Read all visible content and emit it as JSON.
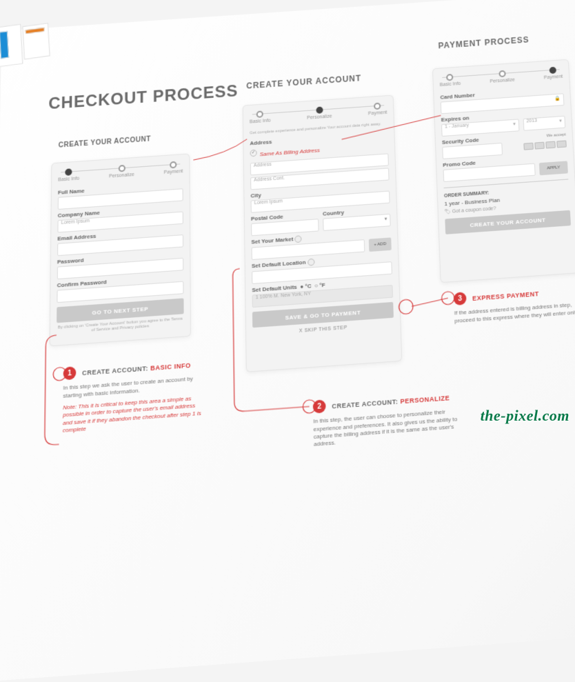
{
  "main_title": "CHECKOUT PROCESS",
  "columns": {
    "col1": {
      "title": "CREATE YOUR ACCOUNT"
    },
    "col2": {
      "title": "CREATE YOUR ACCOUNT"
    },
    "col3": {
      "title": "PAYMENT PROCESS"
    }
  },
  "steps": {
    "s1": "Basic Info",
    "s2": "Personalize",
    "s3": "Payment"
  },
  "panel1": {
    "full_name": "Full Name",
    "company": "Company Name",
    "company_val": "Lorem Ipsum",
    "email": "Email Address",
    "password": "Password",
    "confirm": "Confirm Password",
    "next_btn": "GO TO NEXT STEP",
    "disclaimer": "By clicking on 'Create Your Account' button you agree to the Terms of Service and Privacy policies"
  },
  "panel2": {
    "intro": "Get complete experience and personalize Your account data right away.",
    "address_lbl": "Address",
    "same_as": "Same As Billing Address",
    "addr_ph": "Address",
    "addr2_ph": "Address Cont.",
    "city_lbl": "City",
    "city_val": "Lorem Ipsum",
    "postal_lbl": "Postal Code",
    "country_lbl": "Country",
    "market_lbl": "Set Your Market",
    "add_btn": "+ ADD",
    "location_lbl": "Set Default Location",
    "units_lbl": "Set Default Units",
    "unit_c": "°C",
    "unit_f": "°F",
    "unit_row": "1   100%   M. New York, NY",
    "save_btn": "SAVE & GO TO PAYMENT",
    "skip": "X  SKIP THIS STEP"
  },
  "panel3": {
    "card_lbl": "Card Number",
    "exp_lbl": "Expires on",
    "month_val": "1 - January",
    "year_val": "2013",
    "sec_lbl": "Security Code",
    "accept": "We accept",
    "promo_lbl": "Promo Code",
    "apply": "APPLY",
    "summary_lbl": "ORDER SUMMARY:",
    "summary_val": "1 year - Business Plan",
    "coupon_q": "Got a coupon code?",
    "create_btn": "CREATE YOUR ACCOUNT"
  },
  "notes": {
    "n1": {
      "num": "1",
      "head1": "CREATE ACCOUNT: ",
      "head2": "BASIC INFO",
      "p1": "In this step we ask the user to create an account by starting with basic information.",
      "p2": "Note: This it is critical to keep this area a simple as possible in order to capture the user's email address and save it if they abandon the checkout after step 1 is complete"
    },
    "n2": {
      "num": "2",
      "head1": "CREATE ACCOUNT: ",
      "head2": "PERSONALIZE",
      "p1": "In this step, the user can choose to personalize their experience and preferences. It also gives us the ability to capture the billing address if it is the same as the user's address."
    },
    "n3": {
      "num": "3",
      "head1": "EXPRESS PAYMENT",
      "p1": "If the address entered is billing address in step, proceed to this express where they will enter only."
    }
  },
  "watermark": "the-pixel.com"
}
